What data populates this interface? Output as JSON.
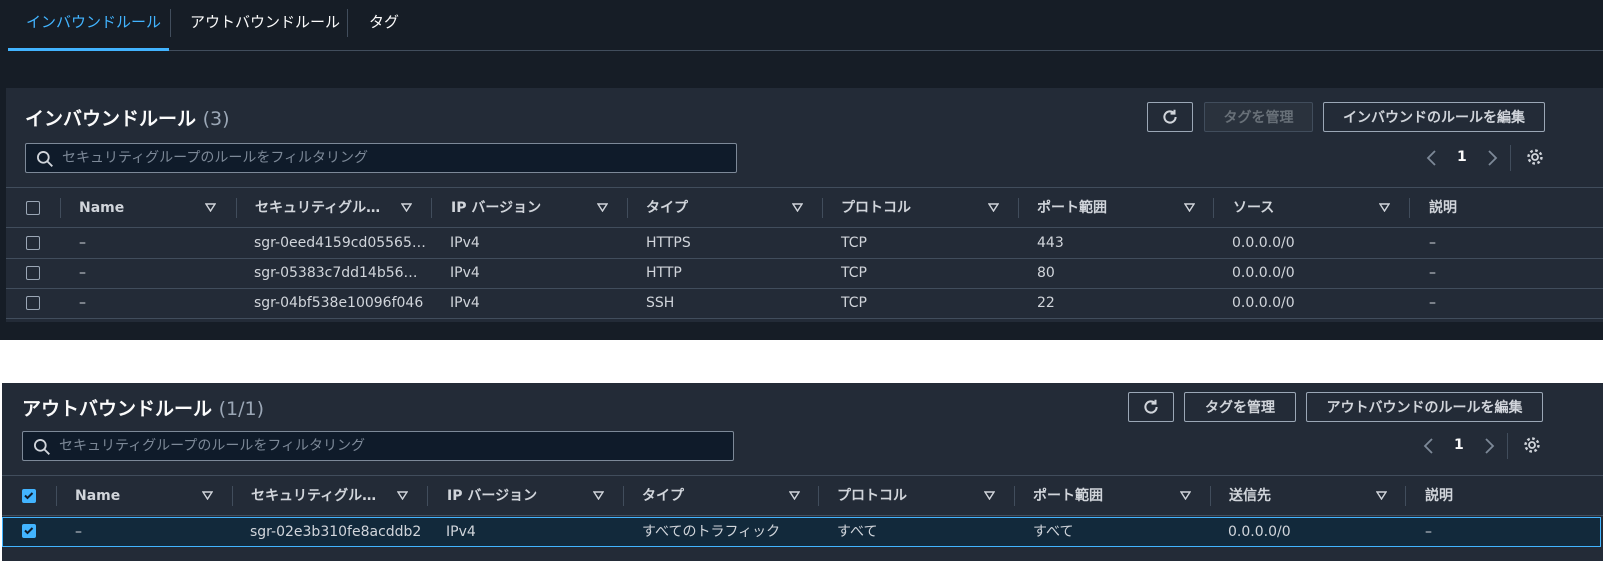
{
  "tabs": [
    {
      "label": "インバウンドルール",
      "active": true
    },
    {
      "label": "アウトバウンドルール",
      "active": false
    },
    {
      "label": "タグ",
      "active": false
    }
  ],
  "inbound": {
    "title": "インバウンドルール",
    "count": "(3)",
    "refresh_icon": "refresh-icon",
    "manage_tags_label": "タグを管理",
    "edit_label": "インバウンドのルールを編集",
    "search_placeholder": "セキュリティグループのルールをフィルタリング",
    "page": "1",
    "columns": [
      "Name",
      "セキュリティグル…",
      "IP バージョン",
      "タイプ",
      "プロトコル",
      "ポート範囲",
      "ソース",
      "説明"
    ],
    "rows": [
      {
        "name": "–",
        "sgr": "sgr-0eed4159cd05565…",
        "ip": "IPv4",
        "type": "HTTPS",
        "protocol": "TCP",
        "port": "443",
        "source": "0.0.0.0/0",
        "desc": "–"
      },
      {
        "name": "–",
        "sgr": "sgr-05383c7dd14b56…",
        "ip": "IPv4",
        "type": "HTTP",
        "protocol": "TCP",
        "port": "80",
        "source": "0.0.0.0/0",
        "desc": "–"
      },
      {
        "name": "–",
        "sgr": "sgr-04bf538e10096f046",
        "ip": "IPv4",
        "type": "SSH",
        "protocol": "TCP",
        "port": "22",
        "source": "0.0.0.0/0",
        "desc": "–"
      }
    ]
  },
  "outbound": {
    "title": "アウトバウンドルール",
    "count": "(1/1)",
    "refresh_icon": "refresh-icon",
    "manage_tags_label": "タグを管理",
    "edit_label": "アウトバウンドのルールを編集",
    "search_placeholder": "セキュリティグループのルールをフィルタリング",
    "page": "1",
    "columns": [
      "Name",
      "セキュリティグル…",
      "IP バージョン",
      "タイプ",
      "プロトコル",
      "ポート範囲",
      "送信先",
      "説明"
    ],
    "rows": [
      {
        "name": "–",
        "sgr": "sgr-02e3b310fe8acddb2",
        "ip": "IPv4",
        "type": "すべてのトラフィック",
        "protocol": "すべて",
        "port": "すべて",
        "dest": "0.0.0.0/0",
        "desc": "–",
        "selected": true
      }
    ]
  },
  "colors": {
    "accent": "#42b4ff",
    "background": "#161d26",
    "panel": "#232b37"
  }
}
